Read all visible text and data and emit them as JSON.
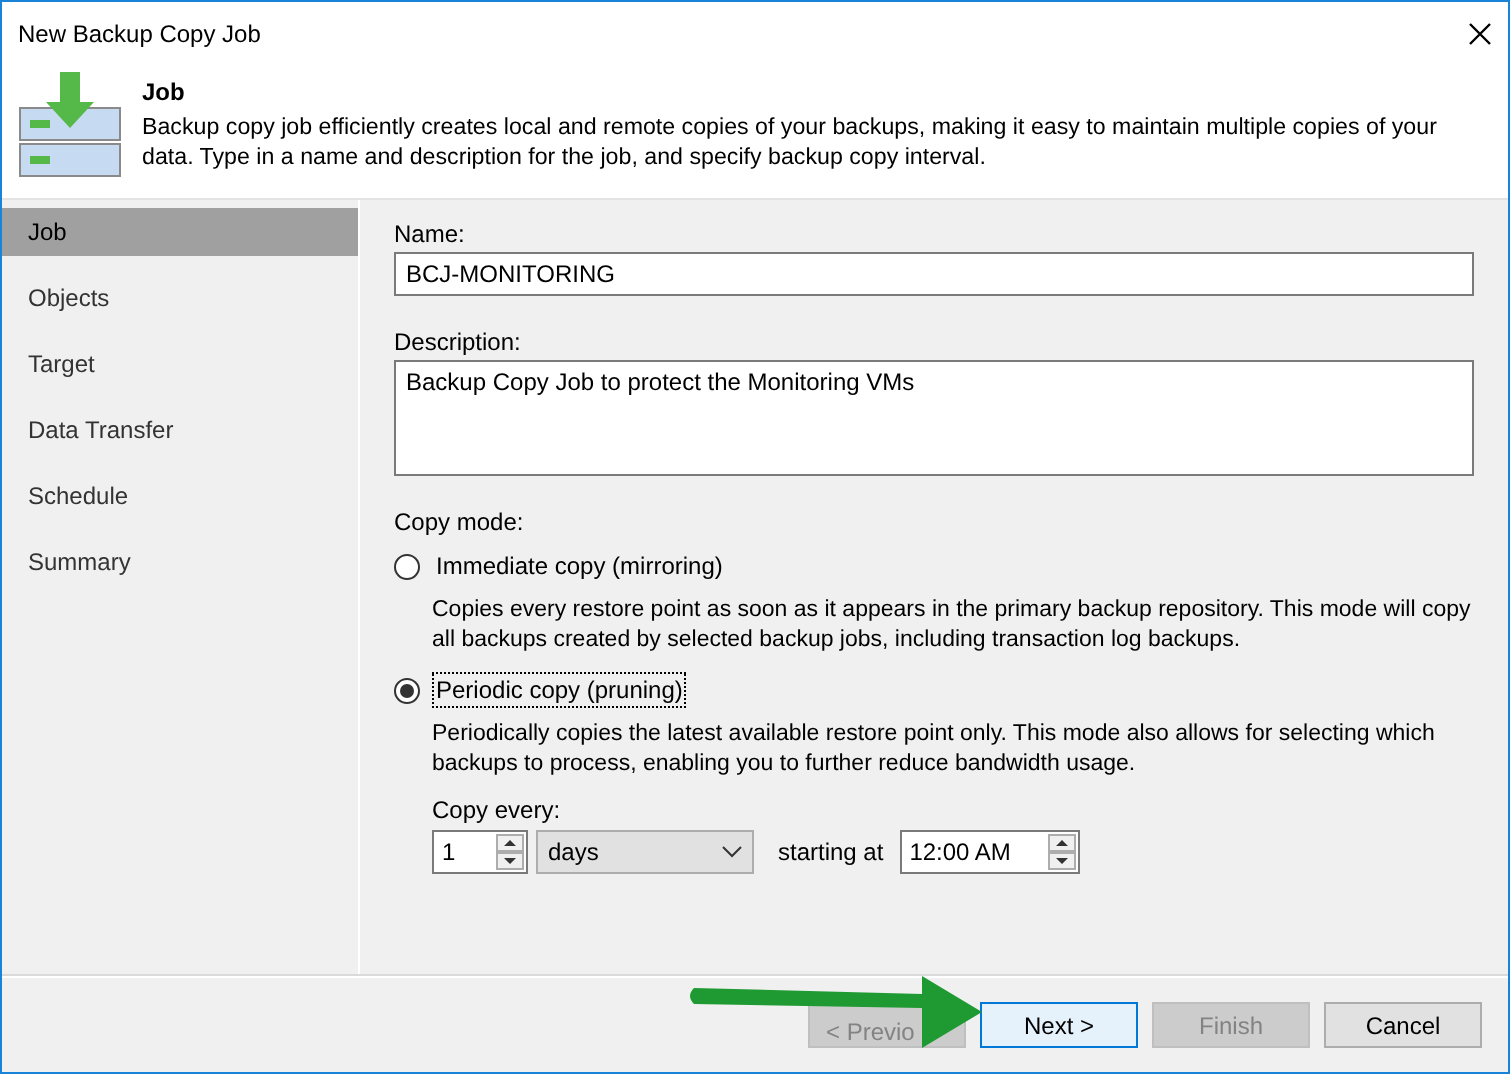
{
  "window": {
    "title": "New Backup Copy Job"
  },
  "header": {
    "title": "Job",
    "description": "Backup copy job efficiently creates local and remote copies of your backups, making it easy to maintain multiple copies of your data. Type in a name and description for the job, and specify backup copy interval."
  },
  "sidebar": {
    "items": [
      {
        "label": "Job",
        "selected": true
      },
      {
        "label": "Objects",
        "selected": false
      },
      {
        "label": "Target",
        "selected": false
      },
      {
        "label": "Data Transfer",
        "selected": false
      },
      {
        "label": "Schedule",
        "selected": false
      },
      {
        "label": "Summary",
        "selected": false
      }
    ]
  },
  "form": {
    "name": {
      "label": "Name:",
      "value": "BCJ-MONITORING"
    },
    "description": {
      "label": "Description:",
      "value": "Backup Copy Job to protect the Monitoring VMs"
    },
    "copy_mode": {
      "label": "Copy mode:",
      "options": [
        {
          "label": "Immediate copy (mirroring)",
          "selected": false,
          "focused": false,
          "description": "Copies every restore point as soon as it appears in the primary backup repository. This mode will copy all backups created by selected backup jobs, including transaction log backups."
        },
        {
          "label": "Periodic copy (pruning)",
          "selected": true,
          "focused": true,
          "description": "Periodically copies the latest available restore point only. This mode also allows for selecting which backups to process, enabling you to further reduce bandwidth usage."
        }
      ]
    },
    "copy_every": {
      "label": "Copy every:",
      "interval": "1",
      "unit": "days",
      "starting_label": "starting at",
      "time": "12:00 AM"
    }
  },
  "buttons": [
    {
      "label": "< Previo",
      "disabled": true,
      "focused": false
    },
    {
      "label": "Next >",
      "disabled": false,
      "focused": true
    },
    {
      "label": "Finish",
      "disabled": true,
      "focused": false
    },
    {
      "label": "Cancel",
      "disabled": false,
      "focused": false
    }
  ]
}
